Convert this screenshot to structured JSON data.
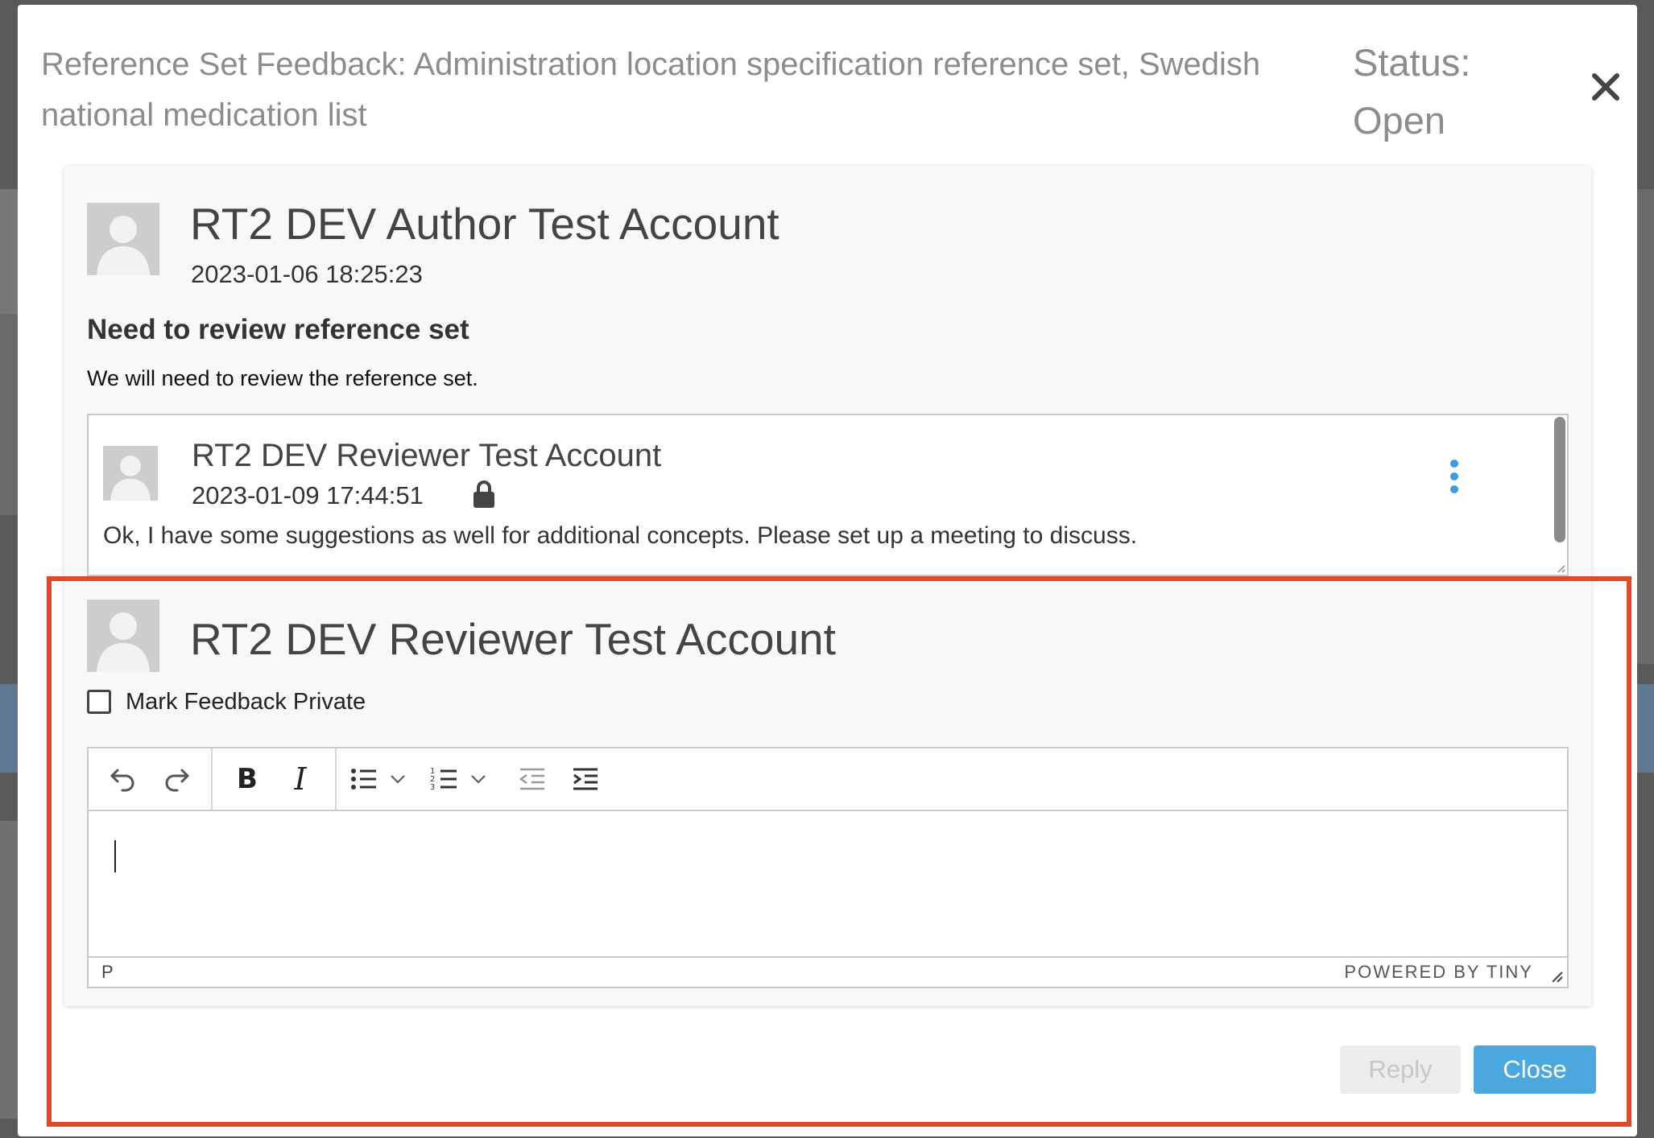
{
  "modal": {
    "title": "Reference Set Feedback: Administration location specification reference set, Swedish national medication list",
    "status": "Status: Open"
  },
  "feedback": {
    "author": "RT2 DEV Author Test Account",
    "date": "2023-01-06 18:25:23",
    "subject": "Need to review reference set",
    "body": "We will need to review the reference set."
  },
  "replies": [
    {
      "author": "RT2 DEV Reviewer Test Account",
      "date": "2023-01-09 17:44:51",
      "private": true,
      "text": "Ok, I have some suggestions as well for additional concepts. Please set up a meeting to discuss."
    }
  ],
  "composer": {
    "author": "RT2 DEV Reviewer Test Account",
    "private_label": "Mark Feedback Private",
    "private_checked": false,
    "editor": {
      "path": "P",
      "branding": "POWERED BY TINY",
      "bold_label": "B",
      "italic_label": "I",
      "toolbar": [
        "undo-icon",
        "redo-icon",
        "bold-icon",
        "italic-icon",
        "bullet-list-icon",
        "numbered-list-icon",
        "outdent-icon",
        "indent-icon"
      ]
    }
  },
  "footer": {
    "reply_label": "Reply",
    "close_label": "Close"
  },
  "colors": {
    "primary": "#4aa8de",
    "highlight": "#e04a2c",
    "kebab": "#3d9be0"
  }
}
